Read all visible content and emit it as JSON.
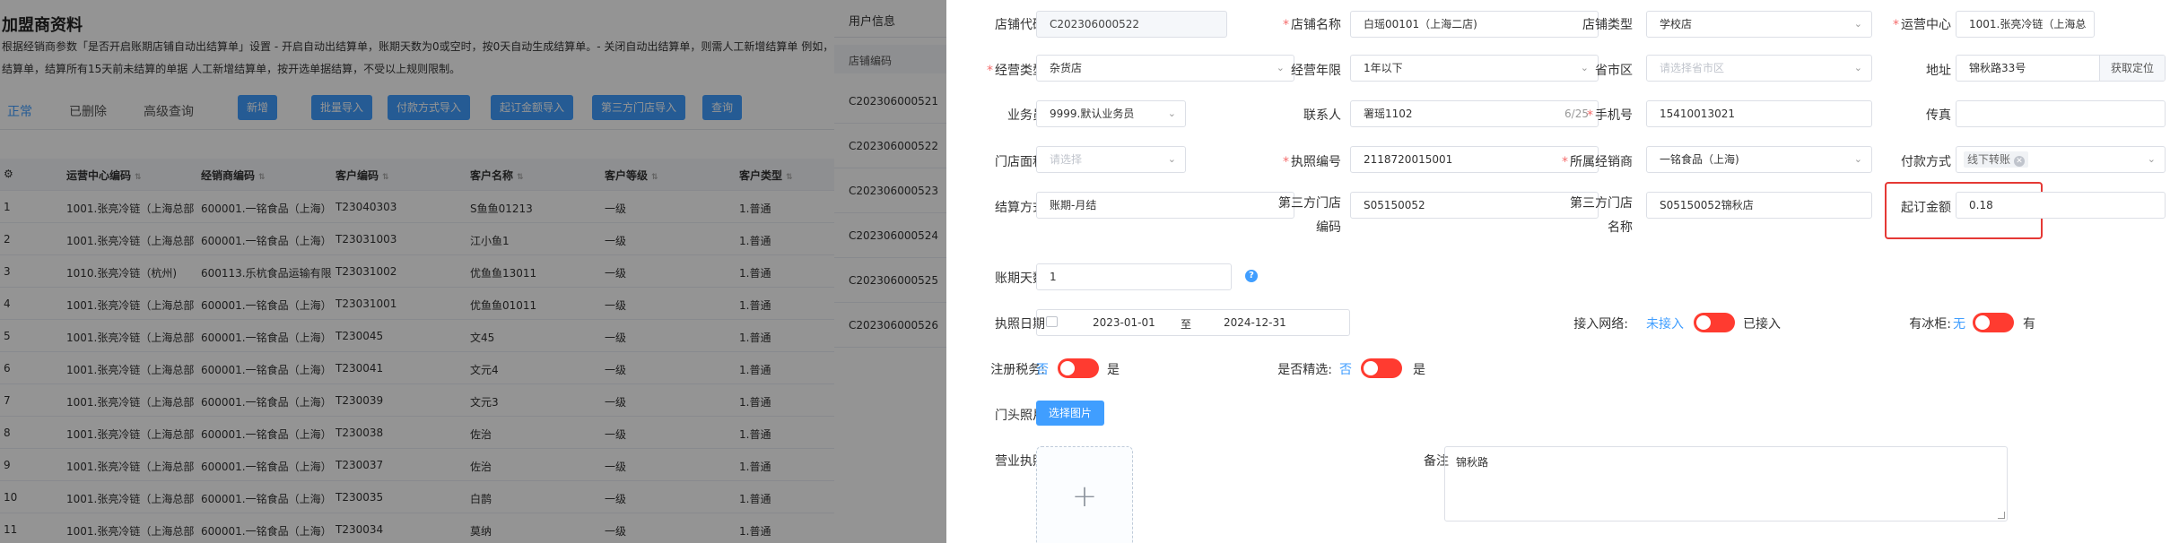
{
  "bg": {
    "title": "加盟商资料",
    "desc_line1": "根据经销商参数「是否开启账期店铺自动出结算单」设置 - 开启自动出结算单，账期天数为0或空时，按0天自动生成结算单。- 关闭自动出结算单，则需人工新增结算单 例如，",
    "desc_line2": "结算单，结算所有15天前未结算的单据 人工新增结算单，按开选单据结算，不受以上规则限制。",
    "tabs": [
      "正常",
      "已删除",
      "高级查询"
    ],
    "buttons": [
      "新增",
      "批量导入",
      "付款方式导入",
      "起订金额导入",
      "第三方门店导入",
      "查询"
    ],
    "columns": [
      "运营中心编码",
      "经销商编码",
      "客户编码",
      "客户名称",
      "客户等级",
      "客户类型"
    ],
    "rows": [
      [
        "1",
        "1001.张亮冷链（上海总部",
        "600001.一铭食品（上海）",
        "T23040303",
        "S鱼鱼01213",
        "一级",
        "1.普通"
      ],
      [
        "2",
        "1001.张亮冷链（上海总部",
        "600001.一铭食品（上海）",
        "T23031003",
        "江小鱼1",
        "一级",
        "1.普通"
      ],
      [
        "3",
        "1010.张亮冷链（杭州)",
        "600113.乐杭食品运输有限",
        "T23031002",
        "优鱼鱼13011",
        "一级",
        "1.普通"
      ],
      [
        "4",
        "1001.张亮冷链（上海总部",
        "600001.一铭食品（上海）",
        "T23031001",
        "优鱼鱼01011",
        "一级",
        "1.普通"
      ],
      [
        "5",
        "1001.张亮冷链（上海总部",
        "600001.一铭食品（上海）",
        "T230045",
        "文45",
        "一级",
        "1.普通"
      ],
      [
        "6",
        "1001.张亮冷链（上海总部",
        "600001.一铭食品（上海）",
        "T230041",
        "文元4",
        "一级",
        "1.普通"
      ],
      [
        "7",
        "1001.张亮冷链（上海总部",
        "600001.一铭食品（上海）",
        "T230039",
        "文元3",
        "一级",
        "1.普通"
      ],
      [
        "8",
        "1001.张亮冷链（上海总部",
        "600001.一铭食品（上海）",
        "T230038",
        "佐治",
        "一级",
        "1.普通"
      ],
      [
        "9",
        "1001.张亮冷链（上海总部",
        "600001.一铭食品（上海）",
        "T230037",
        "佐治",
        "一级",
        "1.普通"
      ],
      [
        "10",
        "1001.张亮冷链（上海总部",
        "600001.一铭食品（上海）",
        "T230035",
        "白鹊",
        "一级",
        "1.普通"
      ],
      [
        "11",
        "1001.张亮冷链（上海总部",
        "600001.一铭食品（上海）",
        "T230034",
        "莫纳",
        "一级",
        "1.普通"
      ]
    ]
  },
  "panel2": {
    "title": "用户信息",
    "col_header": "店铺编码",
    "rows": [
      "C202306000521",
      "C202306000522",
      "C202306000523",
      "C202306000524",
      "C202306000525",
      "C202306000526"
    ]
  },
  "form": {
    "store_code": {
      "label": "店铺代码",
      "value": "C202306000522"
    },
    "store_name": {
      "label": "店铺名称",
      "value": "白瑶00101（上海二店)"
    },
    "store_type": {
      "label": "店铺类型",
      "value": "学校店"
    },
    "ops_center": {
      "label": "运营中心",
      "value": "1001.张亮冷链（上海总"
    },
    "biz_type": {
      "label": "经营类型",
      "value": "杂货店"
    },
    "biz_years": {
      "label": "经营年限",
      "value": "1年以下"
    },
    "region": {
      "label": "省市区",
      "placeholder": "请选择省市区"
    },
    "address": {
      "label": "地址",
      "value": "锦秋路33号",
      "action": "获取定位"
    },
    "salesman": {
      "label": "业务员",
      "value": "9999.默认业务员"
    },
    "contact": {
      "label": "联系人",
      "value": "署瑶1102",
      "counter": "6/25"
    },
    "phone": {
      "label": "手机号",
      "value": "15410013021"
    },
    "fax": {
      "label": "传真",
      "value": ""
    },
    "area": {
      "label": "门店面积",
      "placeholder": "请选择"
    },
    "license_no": {
      "label": "执照编号",
      "value": "2118720015001"
    },
    "dealer": {
      "label": "所属经销商",
      "value": "一铭食品（上海)"
    },
    "pay_method": {
      "label": "付款方式",
      "tag": "线下转账"
    },
    "settle_method": {
      "label": "结算方式",
      "value": "账期-月结"
    },
    "third_code": {
      "label_l1": "第三方门店",
      "label_l2": "编码",
      "value": "S05150052"
    },
    "third_name": {
      "label_l1": "第三方门店",
      "label_l2": "名称",
      "value": "S05150052锦秋店"
    },
    "min_amount": {
      "label": "起订金额",
      "value": "0.18"
    },
    "credit_days": {
      "label": "账期天数",
      "value": "1"
    },
    "license_date": {
      "label": "执照日期",
      "start": "2023-01-01",
      "to": "至",
      "end": "2024-12-31"
    },
    "network": {
      "label": "接入网络:",
      "off": "未接入",
      "on": "已接入"
    },
    "freezer": {
      "label": "有冰柜:",
      "off": "无",
      "on": "有"
    },
    "tax": {
      "label": "注册税务:",
      "off": "否",
      "on": "是"
    },
    "selected": {
      "label": "是否精选:",
      "off": "否",
      "on": "是"
    },
    "door_photo": {
      "label": "门头照片",
      "button": "选择图片"
    },
    "biz_license": {
      "label": "营业执照"
    },
    "remark": {
      "label": "备注",
      "value": "锦秋路"
    }
  },
  "colors": {
    "primary": "#409eff",
    "danger": "#f56c6c",
    "switch_off": "#ff3b30",
    "highlight": "#e53935"
  }
}
